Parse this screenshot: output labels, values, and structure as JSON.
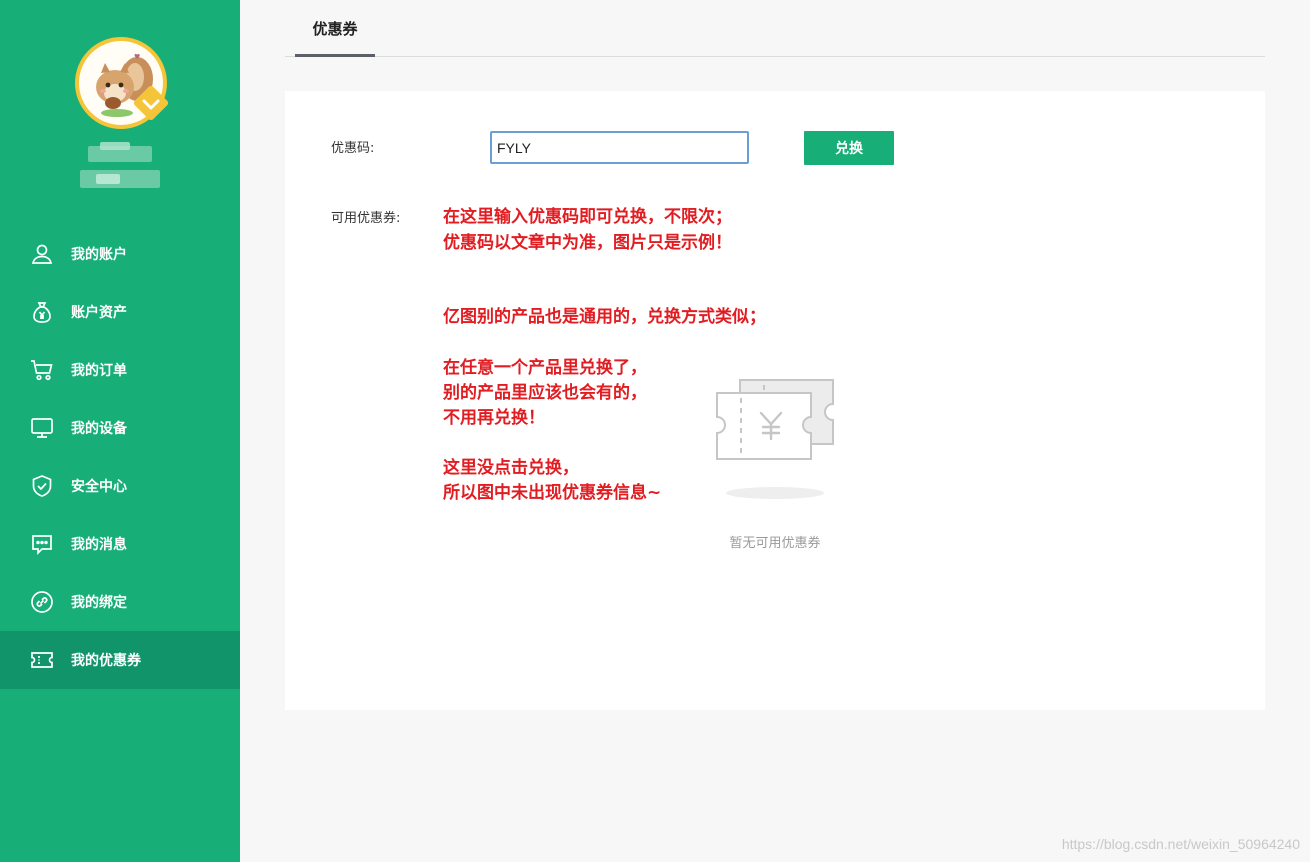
{
  "sidebar": {
    "items": [
      {
        "label": "我的账户",
        "icon": "user-icon"
      },
      {
        "label": "账户资产",
        "icon": "money-bag-icon"
      },
      {
        "label": "我的订单",
        "icon": "cart-icon"
      },
      {
        "label": "我的设备",
        "icon": "monitor-icon"
      },
      {
        "label": "安全中心",
        "icon": "shield-icon"
      },
      {
        "label": "我的消息",
        "icon": "message-icon"
      },
      {
        "label": "我的绑定",
        "icon": "link-icon"
      },
      {
        "label": "我的优惠券",
        "icon": "coupon-icon",
        "active": true
      }
    ]
  },
  "tabs": {
    "coupon": "优惠券"
  },
  "form": {
    "code_label": "优惠码:",
    "code_value": "FYLY",
    "redeem_button": "兑换",
    "available_label": "可用优惠券:"
  },
  "notes": {
    "line1": "在这里输入优惠码即可兑换，不限次；",
    "line2": "优惠码以文章中为准，图片只是示例！",
    "line3": "亿图别的产品也是通用的，兑换方式类似；",
    "line4": "在任意一个产品里兑换了，",
    "line5": "别的产品里应该也会有的，",
    "line6": "不用再兑换！",
    "line7": "这里没点击兑换，",
    "line8": "所以图中未出现优惠券信息~"
  },
  "empty": {
    "text": "暂无可用优惠券"
  },
  "watermark": "https://blog.csdn.net/weixin_50964240",
  "colors": {
    "sidebar": "#17ae78",
    "sidebar_active": "#12946a",
    "accent_border": "#f4c538",
    "note_red": "#e11d22"
  }
}
